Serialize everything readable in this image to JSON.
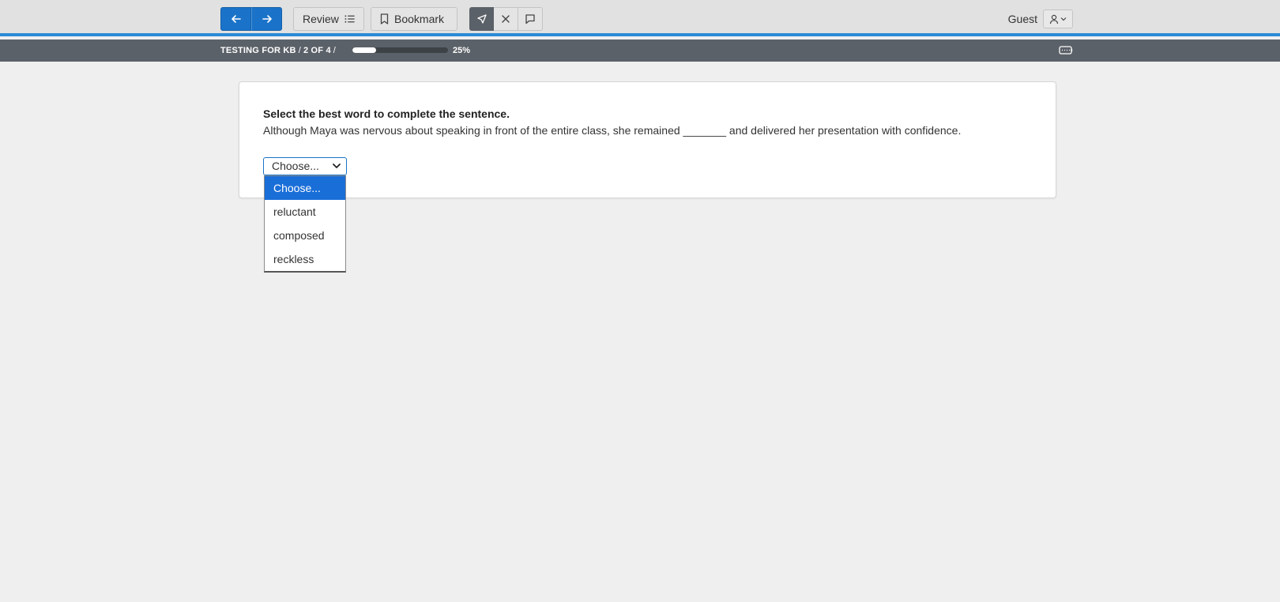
{
  "toolbar": {
    "review_label": "Review",
    "bookmark_label": "Bookmark",
    "user_label": "Guest"
  },
  "status": {
    "test_name": "TESTING FOR KB",
    "position": "2 OF 4",
    "progress_fraction": 0.25,
    "progress_text": "25%"
  },
  "question": {
    "instruction": "Select the best word to complete the sentence.",
    "sentence": "Although Maya was nervous about speaking in front of the entire class, she remained _______ and delivered her presentation with confidence.",
    "select_value": "Choose...",
    "options": [
      "Choose...",
      "reluctant",
      "composed",
      "reckless"
    ],
    "highlighted_option": 0
  },
  "colors": {
    "accent": "#1a73c9",
    "accent_stripe": "#2b8ad6",
    "statusbar": "#5b6168",
    "selected_option": "#1a6ed8"
  },
  "icons": [
    "arrow-left-icon",
    "arrow-right-icon",
    "list-icon",
    "bookmark-icon",
    "pointer-icon",
    "close-icon",
    "comment-icon",
    "user-icon",
    "chevron-down-icon",
    "keyboard-icon"
  ]
}
